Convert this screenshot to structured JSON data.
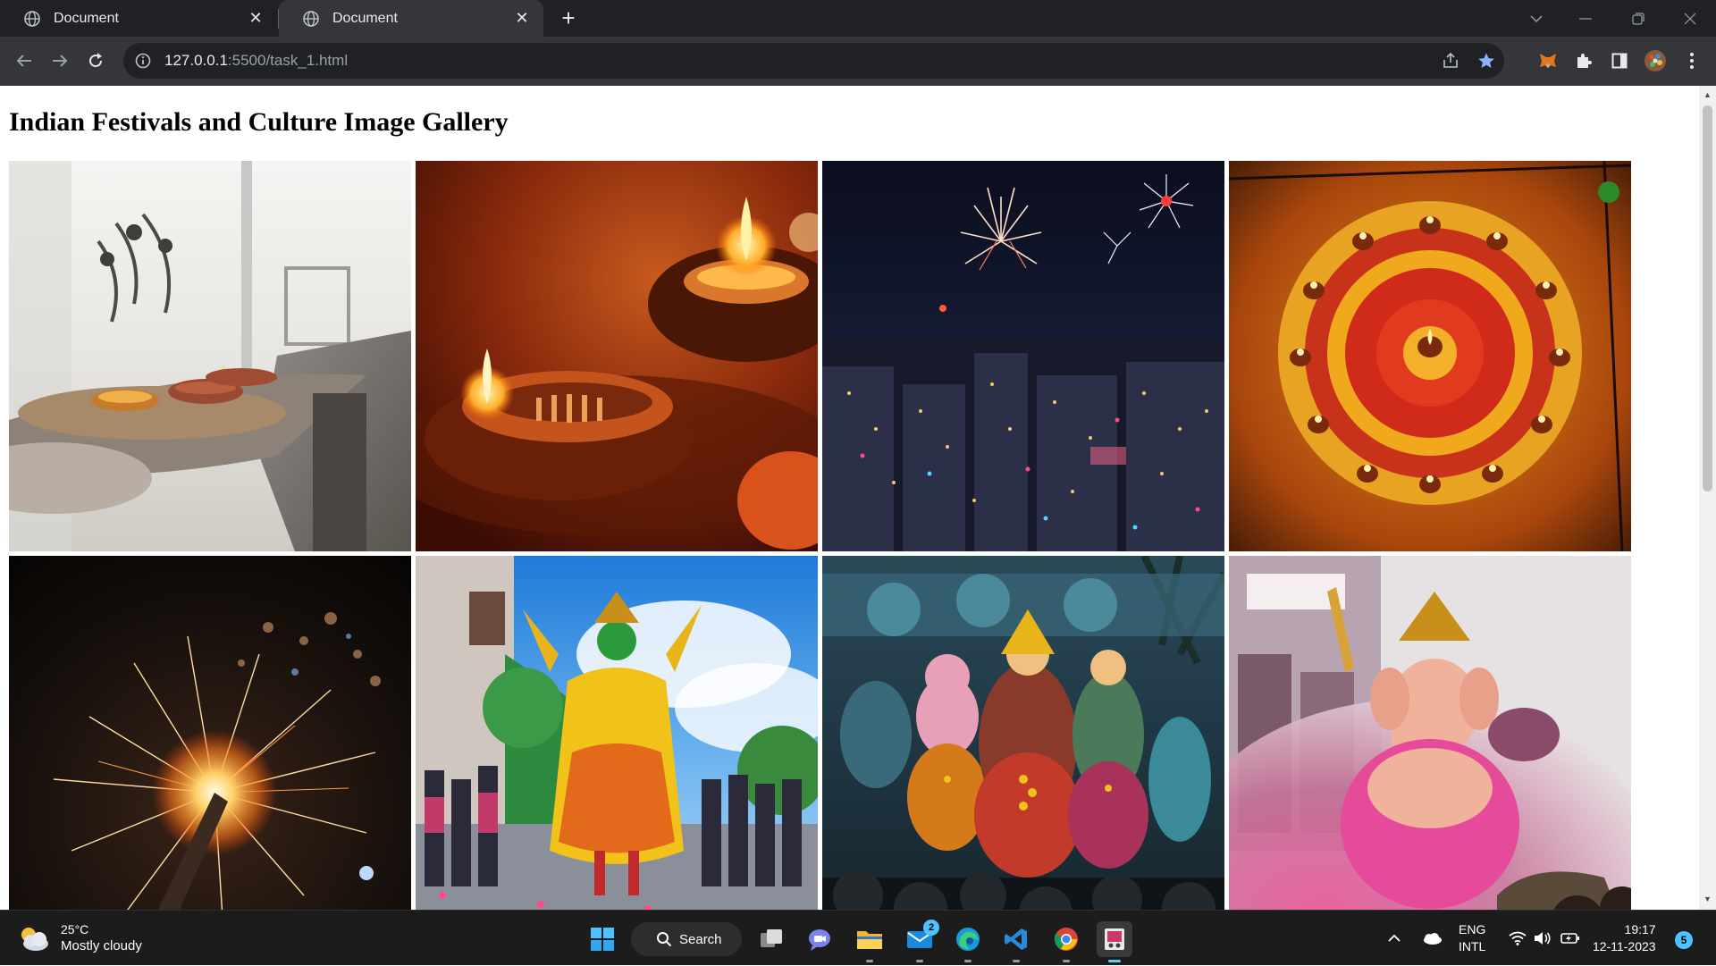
{
  "browser": {
    "tabs": [
      {
        "title": "Document",
        "active": false
      },
      {
        "title": "Document",
        "active": true
      }
    ],
    "url_host": "127.0.0.1",
    "url_rest": ":5500/task_1.html"
  },
  "page": {
    "title": "Indian Festivals and Culture Image Gallery",
    "images": [
      {
        "subject": "diya lamps on a table"
      },
      {
        "subject": "lit clay diyas"
      },
      {
        "subject": "fireworks over city at night"
      },
      {
        "subject": "rangoli with diyas"
      },
      {
        "subject": "sparkler"
      },
      {
        "subject": "kathakali dancer procession"
      },
      {
        "subject": "durga puja idols"
      },
      {
        "subject": "ganesh idol with pink smoke"
      }
    ]
  },
  "taskbar": {
    "weather_temp": "25°C",
    "weather_text": "Mostly cloudy",
    "search_label": "Search",
    "mail_badge": "2",
    "lang_line1": "ENG",
    "lang_line2": "INTL",
    "time": "19:17",
    "date": "12-11-2023",
    "notification_count": "5"
  },
  "colors": {
    "chrome_dark": "#202124",
    "chrome_toolbar": "#35363a",
    "taskbar": "#1c1c1c",
    "accent": "#60cdff"
  }
}
